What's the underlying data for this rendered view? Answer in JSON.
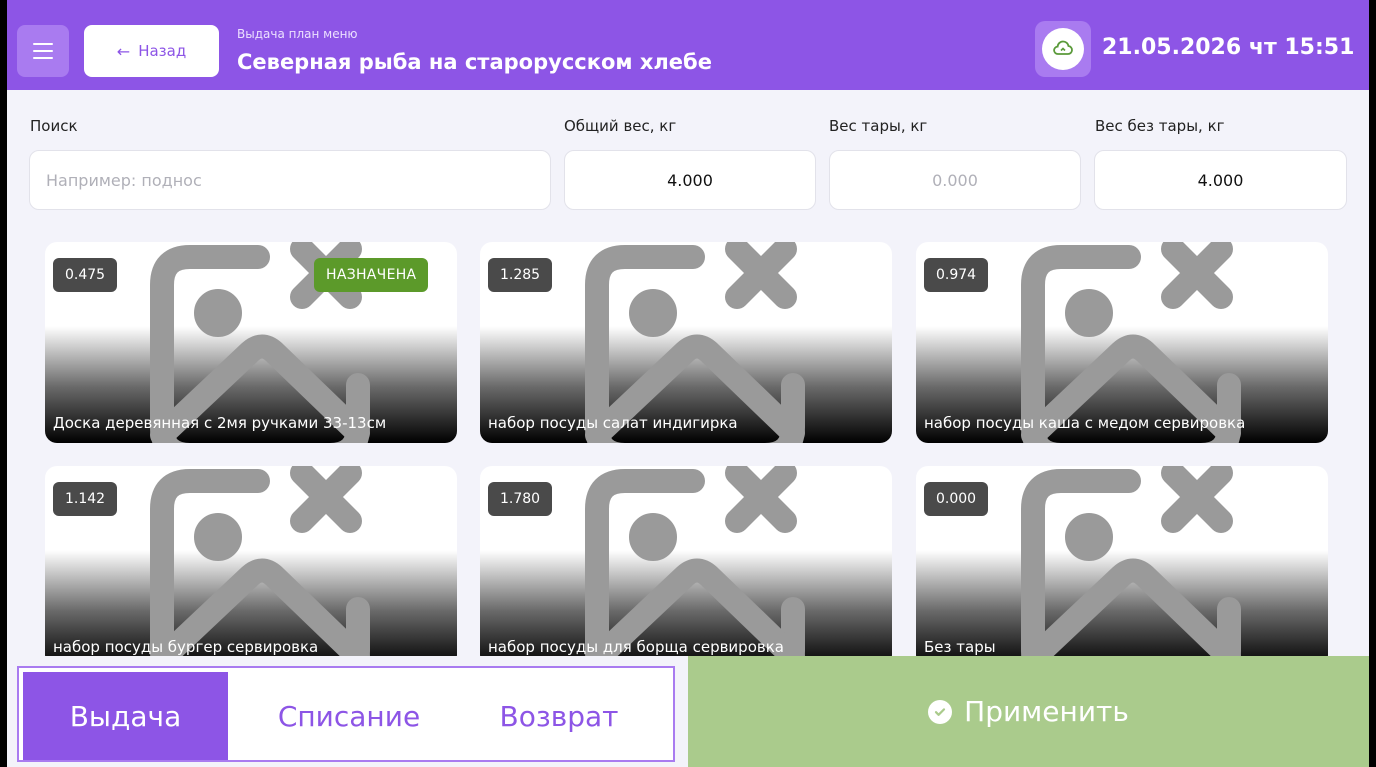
{
  "header": {
    "back_label": "Назад",
    "subtitle": "Выдача план меню",
    "title": "Северная рыба на старорусском хлебе",
    "datetime": "21.05.2026 чт 15:51"
  },
  "form": {
    "search_label": "Поиск",
    "search_placeholder": "Например: поднос",
    "total_label": "Общий вес, кг",
    "total_value": "4.000",
    "tare_label": "Вес тары, кг",
    "tare_value": "0.000",
    "net_label": "Вес без тары, кг",
    "net_value": "4.000"
  },
  "cards": [
    {
      "weight": "0.475",
      "badge": "НАЗНАЧЕНА",
      "name": "Доска деревянная с 2мя ручками 33-13см"
    },
    {
      "weight": "1.285",
      "name": "набор посуды салат индигирка"
    },
    {
      "weight": "0.974",
      "name": "набор посуды каша с медом сервировка"
    },
    {
      "weight": "1.142",
      "name": "набор посуды бургер сервировка"
    },
    {
      "weight": "1.780",
      "name": "набор посуды для борща сервировка"
    },
    {
      "weight": "0.000",
      "name": "Без тары"
    }
  ],
  "tabs": [
    "Выдача",
    "Списание",
    "Возврат"
  ],
  "apply_label": "Применить",
  "colors": {
    "accent": "#8d55e6",
    "assigned": "#5c9a2a",
    "apply": "#aacb8c"
  }
}
